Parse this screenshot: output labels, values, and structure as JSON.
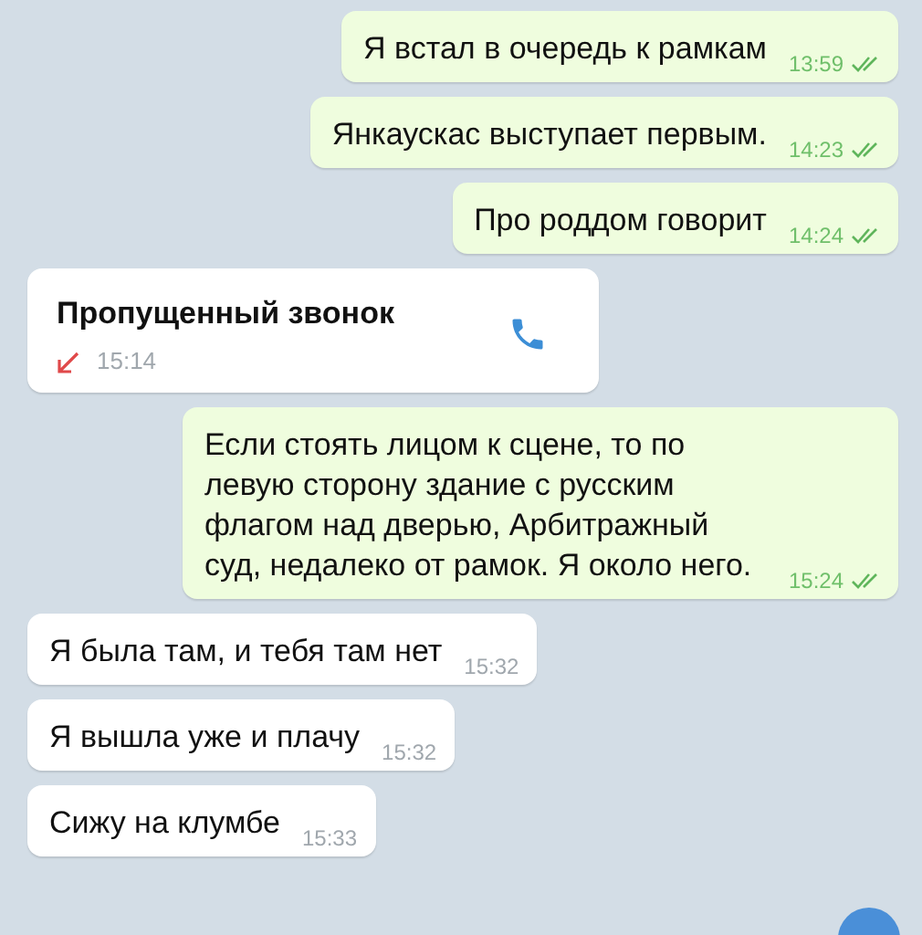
{
  "messages": [
    {
      "kind": "outgoing",
      "text": "Я встал в очередь к рамкам",
      "time": "13:59",
      "read": true
    },
    {
      "kind": "outgoing",
      "text": "Янкаускас выступает первым.",
      "time": "14:23",
      "read": true
    },
    {
      "kind": "outgoing",
      "text": "Про роддом говорит",
      "time": "14:24",
      "read": true
    },
    {
      "kind": "call",
      "text": "Пропущенный звонок",
      "time": "15:14",
      "missed": true
    },
    {
      "kind": "outgoing",
      "text": "Если стоять лицом к сцене, то по левую сторону здание с русским флагом над дверью, Арбитражный суд, недалеко от рамок. Я около него.",
      "time": "15:24",
      "read": true
    },
    {
      "kind": "incoming",
      "text": "Я была там, и тебя там нет",
      "time": "15:32"
    },
    {
      "kind": "incoming",
      "text": "Я вышла уже и плачу",
      "time": "15:32"
    },
    {
      "kind": "incoming",
      "text": "Сижу на клумбе",
      "time": "15:33"
    }
  ]
}
